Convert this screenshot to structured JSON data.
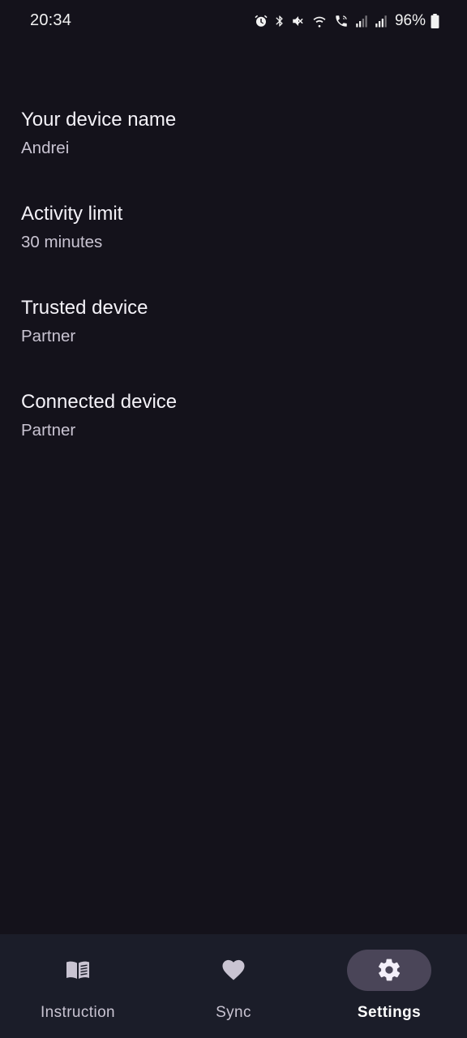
{
  "status_bar": {
    "time": "20:34",
    "battery_percent": "96%",
    "icons": [
      "alarm-icon",
      "bluetooth-icon",
      "mute-icon",
      "wifi-icon",
      "wifi-calling-icon",
      "signal-r-icon",
      "signal-icon",
      "battery-icon"
    ]
  },
  "settings": [
    {
      "title": "Your device name",
      "value": "Andrei"
    },
    {
      "title": "Activity limit",
      "value": "30 minutes"
    },
    {
      "title": "Trusted device",
      "value": "Partner"
    },
    {
      "title": "Connected device",
      "value": "Partner"
    }
  ],
  "bottom_nav": {
    "active": "Settings",
    "items": [
      {
        "label": "Instruction",
        "icon": "book-icon"
      },
      {
        "label": "Sync",
        "icon": "heart-icon"
      },
      {
        "label": "Settings",
        "icon": "gear-icon"
      }
    ]
  },
  "colors": {
    "background": "#14121b",
    "nav_background": "#1b1d29",
    "active_pill": "#4a4558",
    "secondary_text": "#c9c4d2"
  }
}
